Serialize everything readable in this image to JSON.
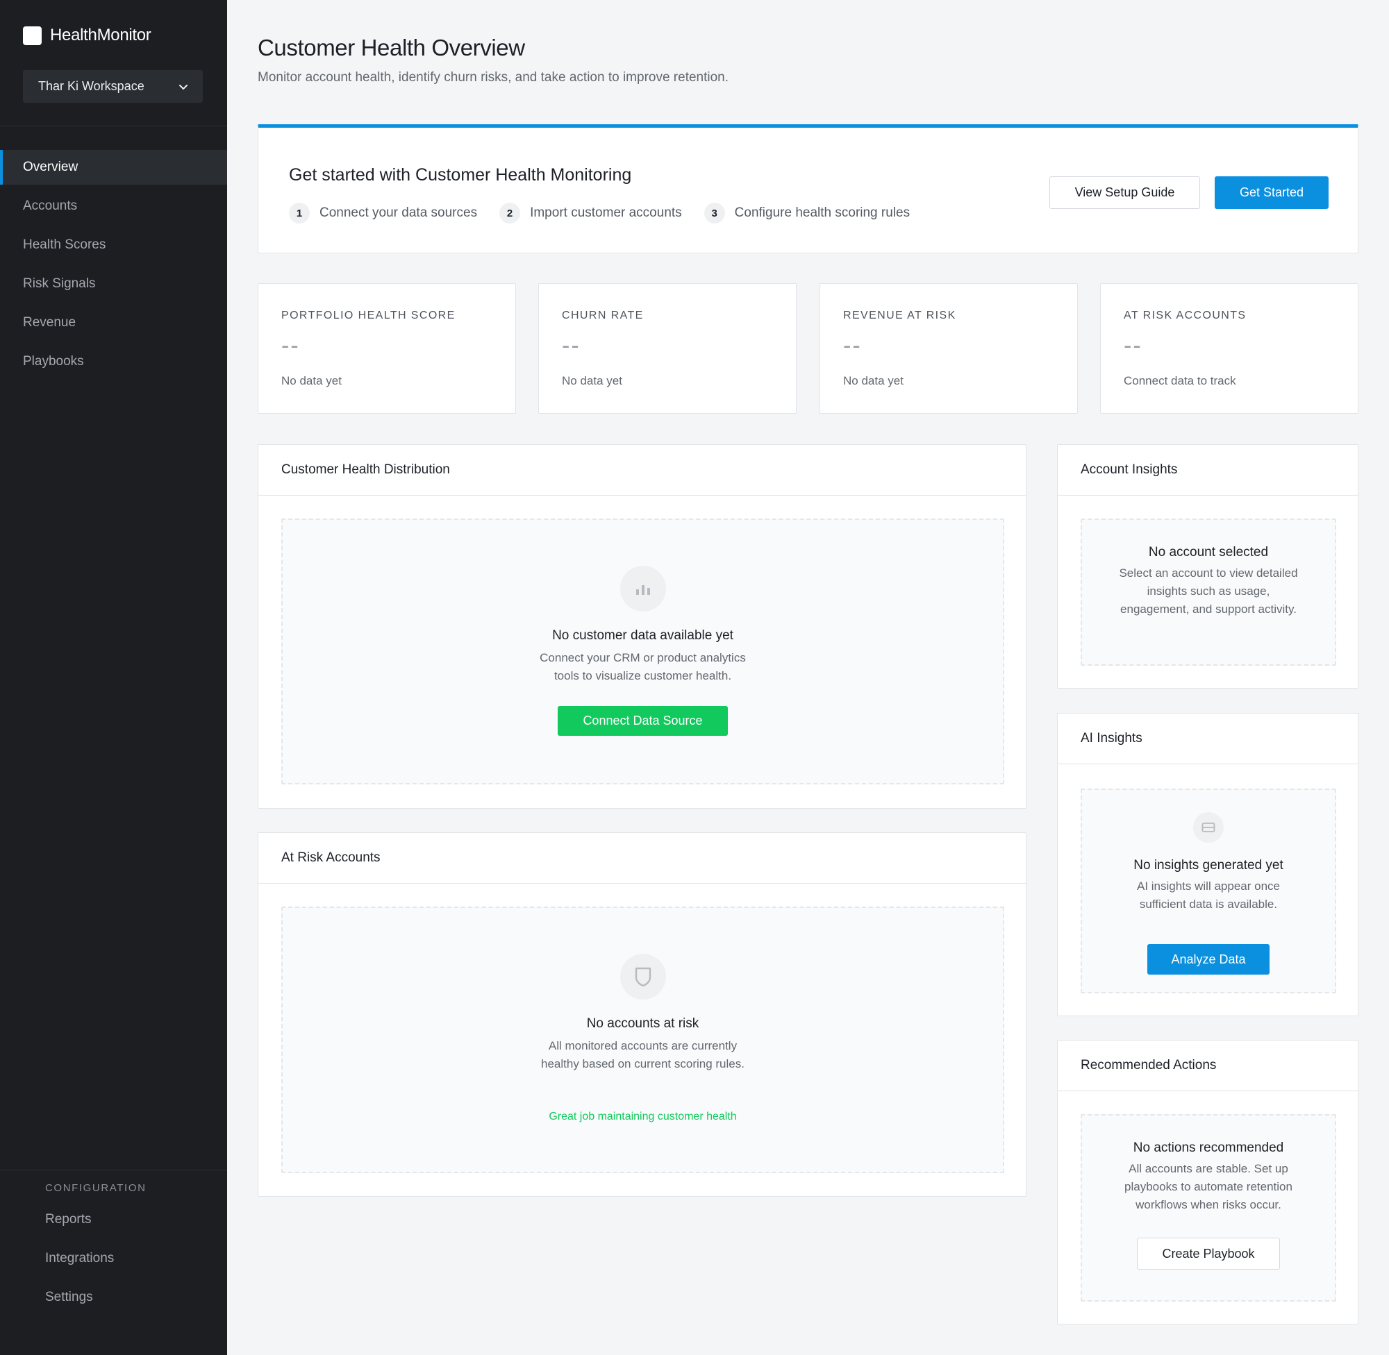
{
  "brand": {
    "name": "HealthMonitor"
  },
  "workspace": {
    "name": "Thar Ki Workspace"
  },
  "nav": {
    "items": [
      {
        "label": "Overview",
        "active": true
      },
      {
        "label": "Accounts"
      },
      {
        "label": "Health Scores"
      },
      {
        "label": "Risk Signals"
      },
      {
        "label": "Revenue"
      },
      {
        "label": "Playbooks"
      }
    ],
    "config_title": "CONFIGURATION",
    "config_items": [
      {
        "label": "Reports"
      },
      {
        "label": "Integrations"
      },
      {
        "label": "Settings"
      }
    ]
  },
  "header": {
    "title": "Customer Health Overview",
    "subtitle": "Monitor account health, identify churn risks, and take action to improve retention."
  },
  "onboarding": {
    "title": "Get started with Customer Health Monitoring",
    "steps": [
      {
        "num": "1",
        "label": "Connect your data sources"
      },
      {
        "num": "2",
        "label": "Import customer accounts"
      },
      {
        "num": "3",
        "label": "Configure health scoring rules"
      }
    ],
    "guide_button": "View Setup Guide",
    "start_button": "Get Started"
  },
  "kpis": [
    {
      "label": "PORTFOLIO HEALTH SCORE",
      "value": "--",
      "note": "No data yet"
    },
    {
      "label": "CHURN RATE",
      "value": "--",
      "note": "No data yet"
    },
    {
      "label": "REVENUE AT RISK",
      "value": "--",
      "note": "No data yet"
    },
    {
      "label": "AT RISK ACCOUNTS",
      "value": "--",
      "note": "Connect data to track"
    }
  ],
  "distribution": {
    "title": "Customer Health Distribution",
    "empty_title": "No customer data available yet",
    "empty_text_1": "Connect your CRM or product analytics",
    "empty_text_2": "tools to visualize customer health.",
    "button": "Connect Data Source",
    "icon": "bar-chart-icon"
  },
  "at_risk": {
    "title": "At Risk Accounts",
    "empty_title": "No accounts at risk",
    "empty_text_1": "All monitored accounts are currently",
    "empty_text_2": "healthy based on current scoring rules.",
    "success": "Great job maintaining customer health",
    "icon": "shield-icon"
  },
  "account_insights": {
    "title": "Account Insights",
    "empty_title": "No account selected",
    "empty_text_1": "Select an account to view detailed",
    "empty_text_2": "insights such as usage,",
    "empty_text_3": "engagement, and support activity."
  },
  "ai_insights": {
    "title": "AI Insights",
    "empty_title": "No insights generated yet",
    "empty_text_1": "AI insights will appear once",
    "empty_text_2": "sufficient data is available.",
    "button": "Analyze Data",
    "icon": "card-icon"
  },
  "recommended": {
    "title": "Recommended Actions",
    "empty_title": "No actions recommended",
    "empty_text_1": "All accounts are stable. Set up",
    "empty_text_2": "playbooks to automate retention",
    "empty_text_3": "workflows when risks occur.",
    "button": "Create Playbook"
  },
  "colors": {
    "sidebar": "#1c1e22",
    "accent": "#0b90e0",
    "success": "#12c95d",
    "background": "#f4f5f6"
  }
}
